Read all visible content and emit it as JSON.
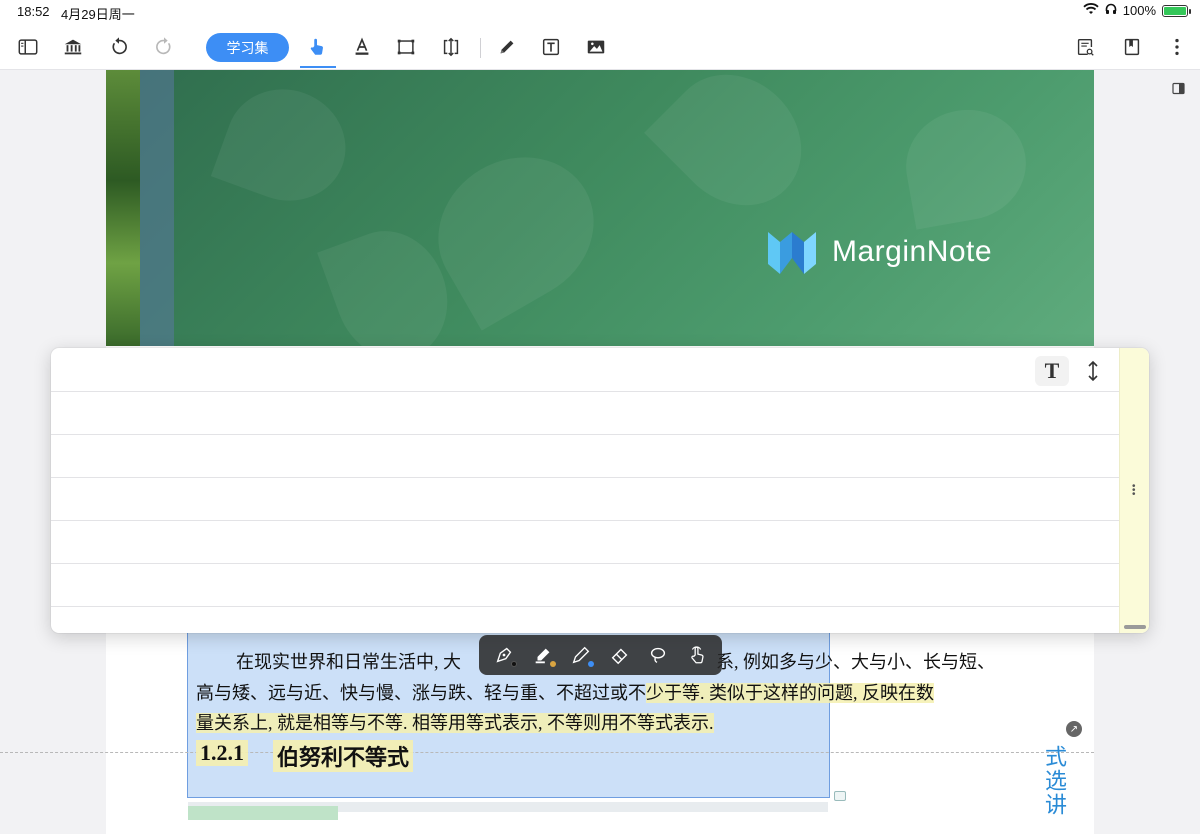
{
  "status_bar": {
    "time": "18:52",
    "date": "4月29日周一",
    "battery": "100%"
  },
  "toolbar": {
    "study_set_label": "学习集",
    "icons": [
      "sidebar-icon",
      "library-icon",
      "undo-icon",
      "redo-icon",
      "hand-icon",
      "text-highlight-icon",
      "rect-select-icon",
      "crop-icon",
      "pen-icon",
      "textbox-icon",
      "image-icon",
      "search-doc-icon",
      "bookmark-icon",
      "more-icon"
    ],
    "accent_color": "#3d8ef5"
  },
  "cover": {
    "brand": "MarginNote"
  },
  "note_card": {
    "text_button": "T",
    "lines": 6
  },
  "document": {
    "line1_a": "在现实世界和日常生活中, 大",
    "line1_b": "系, 例如多与少、大与小、长与短、",
    "line2_a": "高与矮、远与近、快与慢、涨与跌、轻与重、不超过或不",
    "line2_b": "少于等. 类似于这样的问题, 反映在数",
    "line3": "量关系上, 就是相等与不等. 相等用等式表示, 不等则用不等式表示.",
    "section_number": "1.2.1",
    "section_title": "伯努利不等式",
    "vertical_title": "式选讲"
  },
  "pen_toolbar": {
    "tools": [
      "pen-tool-icon",
      "highlighter-icon",
      "marker-icon",
      "eraser-icon",
      "lasso-icon",
      "touch-icon"
    ],
    "colors": [
      "#222222",
      "#d9a441",
      "#3d8ef5"
    ]
  }
}
